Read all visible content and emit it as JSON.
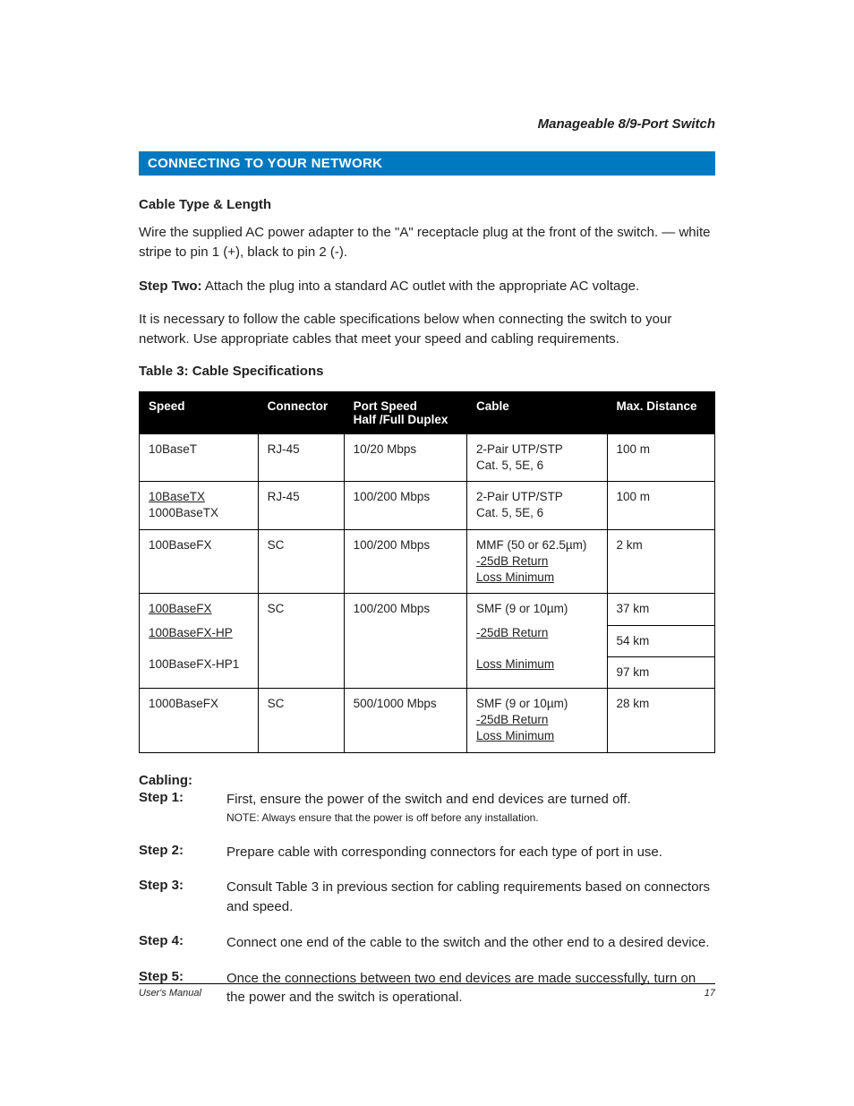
{
  "header": {
    "product": "Manageable 8/9-Port Switch"
  },
  "section_title": "CONNECTING TO YOUR NETWORK",
  "cable_type_heading": "Cable Type & Length",
  "para_wire": "Wire the supplied AC power adapter to the \"A\" receptacle plug at the front of the switch. — white stripe to pin 1 (+), black to pin 2 (-).",
  "step_two_label": "Step Two:",
  "step_two_text": " Attach the plug into a standard AC outlet with the appropriate AC voltage.",
  "para_follow": "It is necessary to follow the cable specifications below when connecting the switch to your network. Use appropriate cables that meet your speed and cabling requirements.",
  "table_caption": "Table 3: Cable Specifications",
  "table": {
    "headers": {
      "speed": "Speed",
      "connector": "Connector",
      "portspeed_l1": "Port Speed",
      "portspeed_l2": "Half /Full Duplex",
      "cable": "Cable",
      "maxdist": "Max. Distance"
    },
    "r1": {
      "speed": "10BaseT",
      "connector": "RJ-45",
      "portspeed": "10/20 Mbps",
      "cable_l1": "2-Pair UTP/STP",
      "cable_l2": "Cat. 5, 5E, 6",
      "maxdist": "100 m"
    },
    "r2": {
      "speed_l1": "10BaseTX",
      "speed_l2": "1000BaseTX",
      "connector": "RJ-45",
      "portspeed": "100/200 Mbps",
      "cable_l1": "2-Pair UTP/STP",
      "cable_l2": "Cat. 5, 5E, 6",
      "maxdist": "100 m"
    },
    "r3": {
      "speed": "100BaseFX",
      "connector": "SC",
      "portspeed": "100/200 Mbps",
      "cable_l1": "MMF (50 or 62.5µm)",
      "cable_l2": "-25dB Return",
      "cable_l3": "Loss Minimum",
      "maxdist": "2 km"
    },
    "r4a": {
      "speed": "100BaseFX",
      "connector": "SC",
      "portspeed": "100/200 Mbps",
      "cable_l1": "SMF (9 or 10µm)",
      "maxdist": "37 km"
    },
    "r4b": {
      "speed": "100BaseFX-HP",
      "cable_l2": "-25dB Return",
      "maxdist": "54 km"
    },
    "r4c": {
      "speed": "100BaseFX-HP1",
      "cable_l3": "Loss Minimum",
      "maxdist": "97 km"
    },
    "r5": {
      "speed": "1000BaseFX",
      "connector": "SC",
      "portspeed": "500/1000 Mbps",
      "cable_l1": "SMF (9 or 10µm)",
      "cable_l2": "-25dB Return",
      "cable_l3": "Loss Minimum",
      "maxdist": "28 km"
    }
  },
  "cabling_heading": "Cabling:",
  "steps": {
    "s1": {
      "label": "Step 1:",
      "text": "First, ensure the power of the switch and end devices are turned off.",
      "note": "NOTE: Always ensure that the power is off before any installation."
    },
    "s2": {
      "label": "Step 2:",
      "text": "Prepare cable with corresponding connectors for each type of port in use."
    },
    "s3": {
      "label": "Step 3:",
      "text": "Consult Table 3 in previous section for cabling requirements based on connectors and speed."
    },
    "s4": {
      "label": "Step 4:",
      "text": "Connect one end of the cable to the switch and the other end to a desired device."
    },
    "s5": {
      "label": "Step 5:",
      "text": "Once the connections between two end devices are made successfully, turn on the power and the switch is operational."
    }
  },
  "footer": {
    "left": "User's Manual",
    "right": "17"
  }
}
